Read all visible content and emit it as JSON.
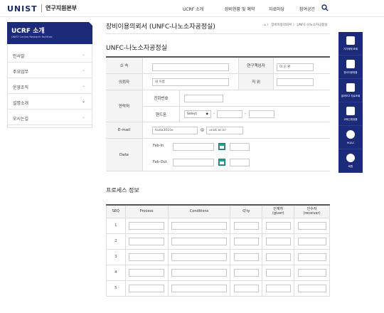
{
  "header": {
    "logo": "UNIST",
    "org": "연구지원본부",
    "nav": [
      "UCRF 소개",
      "장비현황 및 예약",
      "자료마당",
      "참여공간"
    ]
  },
  "lnb": {
    "title": "UCRF 소개",
    "subtitle": "UNIST Central Research Facilities",
    "items": [
      {
        "label": "인사말",
        "arrow": "⌄"
      },
      {
        "label": "주요업무",
        "arrow": "⌄"
      },
      {
        "label": "운영조직",
        "arrow": "⌄"
      },
      {
        "label": "설명소개",
        "arrow": "⌄"
      },
      {
        "label": "오시는길",
        "arrow": "⌄"
      }
    ]
  },
  "breadcrumb": "⌂ 〉 장비이용의뢰서 〉 UNFC-나노소자공정실",
  "page_title": "장비이용의뢰서 (UNFC-나노소자공정실)",
  "section_title": "UNFC-나노소자공정실",
  "form": {
    "labels": {
      "affiliation": "소 속",
      "pi": "연구책임자",
      "requester": "의뢰자",
      "position": "직 위",
      "contact": "연락처",
      "phone": "전화번호",
      "mobile": "핸드폰",
      "email": "E-mail",
      "date": "Date",
      "fab_in": "Fab-In",
      "fab_out": "Fab-Out"
    },
    "values": {
      "requester": "내 이름",
      "pi": "이 순 환",
      "email_id": "tiuda3015e",
      "email_domain": "unist.ac.kr",
      "at": "@",
      "mobile_select": "Select",
      "dash": "-"
    }
  },
  "sidebar": [
    {
      "label": "기기예약/조회",
      "color": "#1c2a7a"
    },
    {
      "label": "장비이용현황",
      "color": "#1c2a7a"
    },
    {
      "label": "결과보고 자료조회",
      "color": "#1c2a7a"
    },
    {
      "label": "교육신청현황",
      "color": "#1c2a7a"
    },
    {
      "label": "HQ&C",
      "color": "#1c2a7a"
    },
    {
      "label": "회원",
      "color": "#1c2a7a"
    }
  ],
  "process": {
    "title": "프로세스 정보",
    "headers": [
      "SEQ",
      "Process",
      "Conditions",
      "Q'ty",
      "인계자\n(giver)",
      "인수자\n(receiver)"
    ],
    "rows": [
      "1",
      "2",
      "3",
      "4",
      "5"
    ]
  }
}
